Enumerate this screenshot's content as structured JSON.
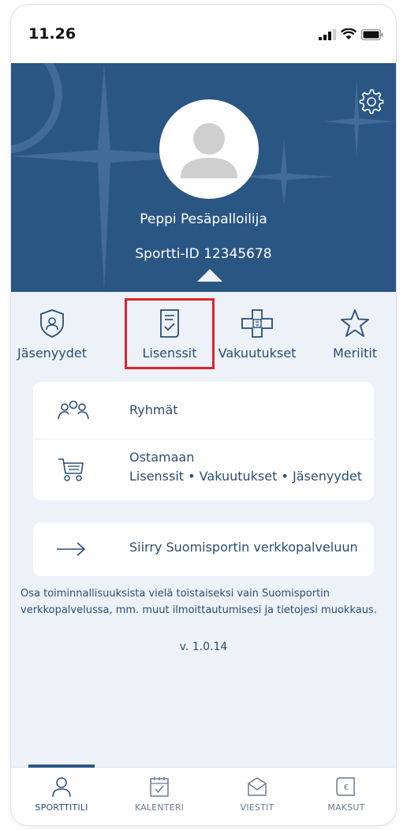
{
  "status_bar": {
    "time": "11.26"
  },
  "profile": {
    "name": "Peppi Pesäpalloilija",
    "sportti_id_label": "Sportti-ID",
    "sportti_id": "12345678"
  },
  "quick_tabs": [
    {
      "label": "Jäsenyydet",
      "icon": "shield-person-icon"
    },
    {
      "label": "Lisenssit",
      "icon": "license-document-icon",
      "highlighted": true
    },
    {
      "label": "Vakuutukset",
      "icon": "cross-bandage-icon"
    },
    {
      "label": "Meriitit",
      "icon": "star-icon"
    }
  ],
  "menu": {
    "groups": {
      "label": "Ryhmät",
      "icon": "people-group-icon"
    },
    "shop": {
      "title": "Ostamaan",
      "subtitle": "Lisenssit • Vakuutukset • Jäsenyydet",
      "icon": "shopping-cart-icon"
    }
  },
  "web_link": {
    "label": "Siirry Suomisportin verkkopalveluun",
    "icon": "arrow-right-icon"
  },
  "info_text": "Osa toiminnallisuuksista vielä toistaiseksi vain Suomisportin verkkopalvelussa, mm. muut ilmoittautumisesi ja tietojesi muokkaus.",
  "version": "v. 1.0.14",
  "bottom_tabs": [
    {
      "label": "SPORTTITILI",
      "icon": "person-icon",
      "active": true
    },
    {
      "label": "KALENTERI",
      "icon": "calendar-icon"
    },
    {
      "label": "VIESTIT",
      "icon": "envelope-icon"
    },
    {
      "label": "MAKSUT",
      "icon": "euro-receipt-icon"
    }
  ],
  "colors": {
    "hero_bg": "#2a5684",
    "page_bg": "#edf2f9",
    "text_primary": "#2a4d73",
    "highlight_border": "#e0232d"
  }
}
